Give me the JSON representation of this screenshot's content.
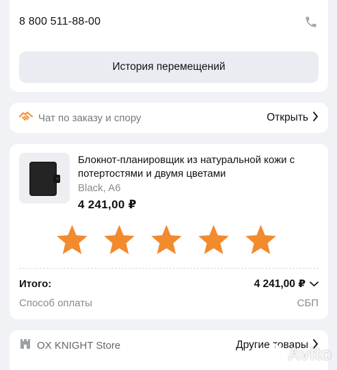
{
  "contact": {
    "phone": "8 800 511-88-00",
    "phone_icon": "phone-icon"
  },
  "history": {
    "label": "История перемещений"
  },
  "chat": {
    "label": "Чат по заказу и спору",
    "action": "Открыть",
    "icon": "handshake-icon"
  },
  "product": {
    "title": "Блокнот-планировщик из натуральной кожи с потертостями и двумя цветами",
    "variant": "Black, A6",
    "price": "4 241,00 ₽",
    "rating": {
      "value": 5,
      "max": 5,
      "color": "#f28a2e"
    }
  },
  "summary": {
    "total_label": "Итого:",
    "total_value": "4 241,00 ₽",
    "payment_label": "Способ оплаты",
    "payment_value": "СБП"
  },
  "store": {
    "name": "OX KNIGHT Store",
    "action": "Другие товары",
    "icon": "store-icon"
  },
  "watermark": {
    "text": "Avito"
  },
  "colors": {
    "accent": "#f28a2e",
    "background": "#f0f2f5",
    "muted": "#8a8a8a"
  }
}
